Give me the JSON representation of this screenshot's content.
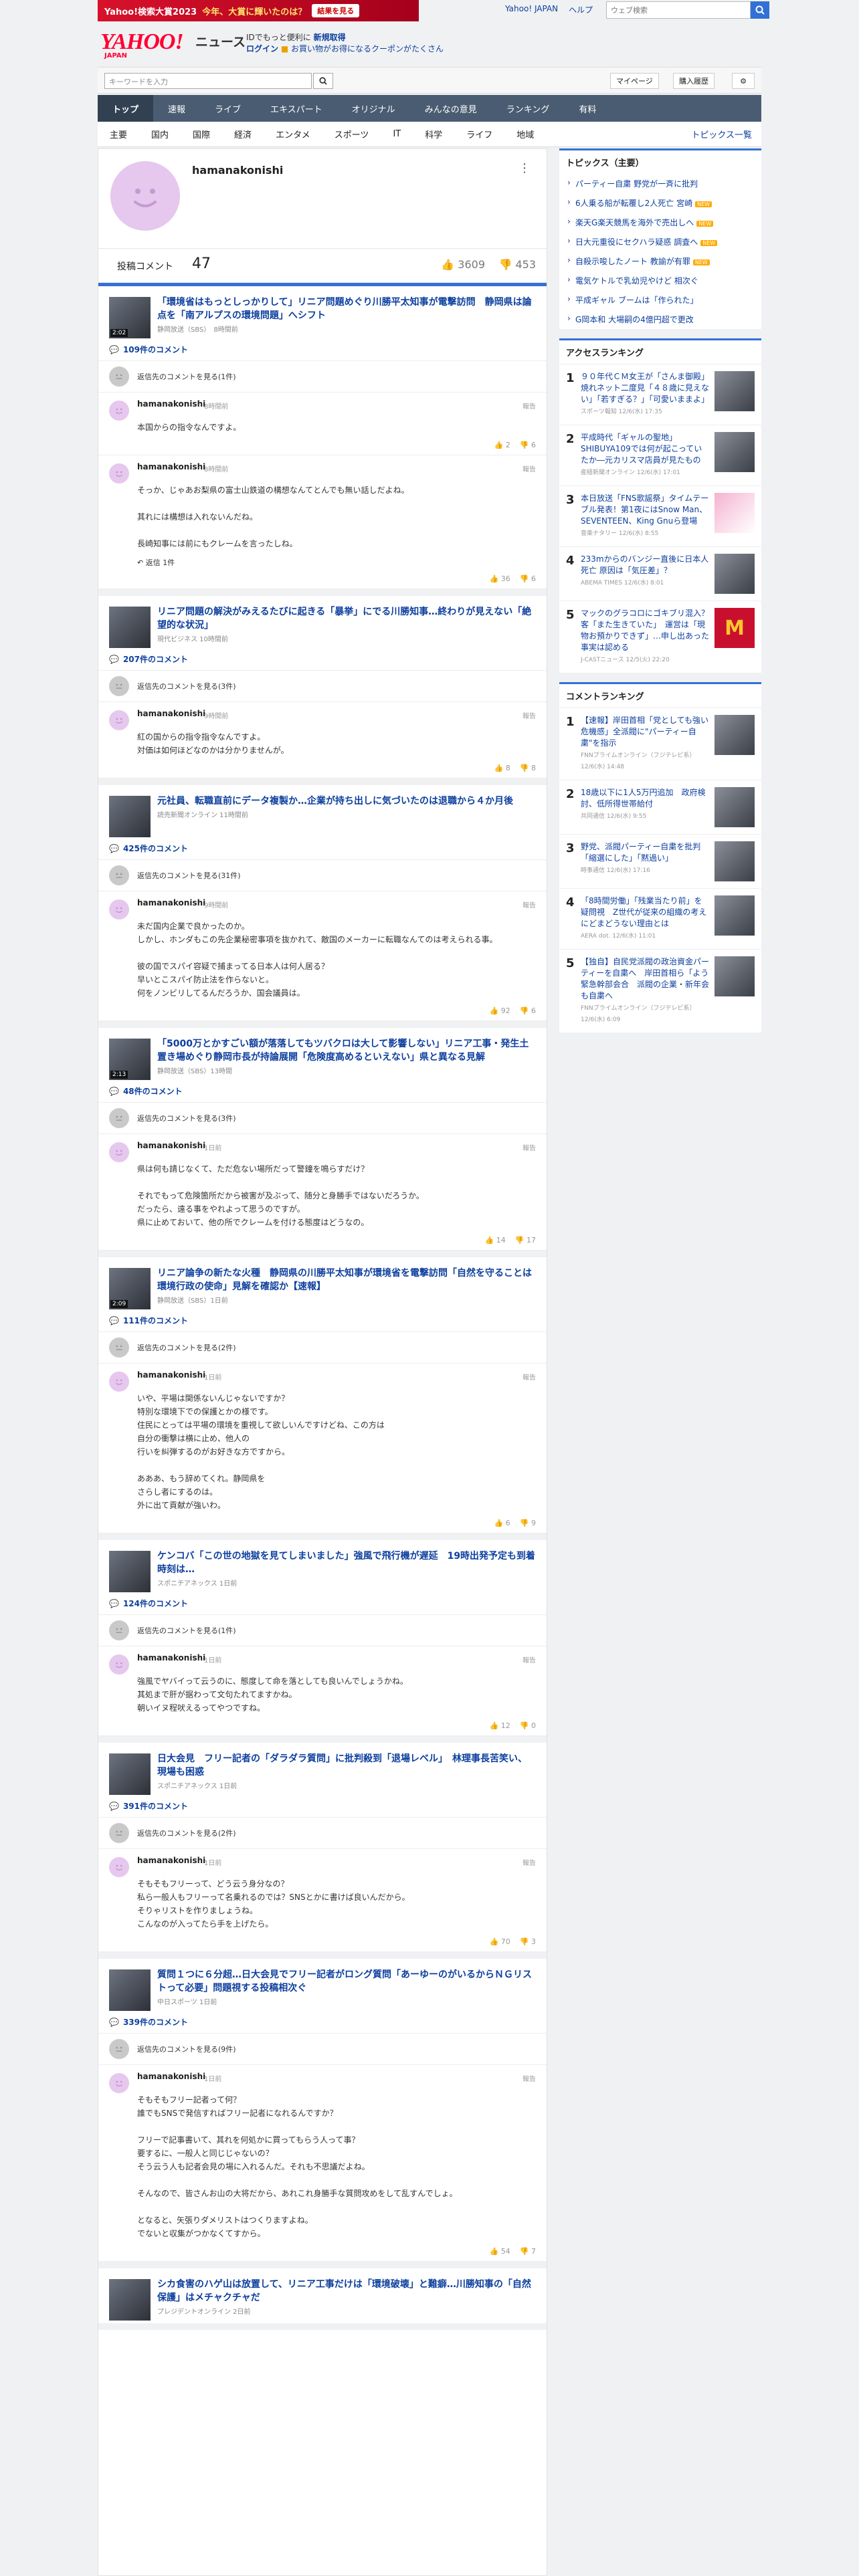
{
  "promo": {
    "text": "Yahoo!検索大賞2023",
    "highlight": "今年、大賞に輝いたのは？",
    "button": "結果を見る"
  },
  "topnav": [
    "Yahoo! JAPAN",
    "ヘルプ"
  ],
  "top_search_placeholder": "ウェブ検索",
  "logo": {
    "brand": "YAHOO!",
    "sub": "JAPAN",
    "product": "ニュース"
  },
  "header_promo": {
    "line1a": "IDでもっと便利に",
    "line1b": "新規取得",
    "line2a": "ログイン",
    "line2b": "お買い物がお得になるクーポンがたくさん"
  },
  "searchbar": {
    "placeholder": "キーワードを入力",
    "mypage": "マイページ",
    "history": "購入履歴"
  },
  "mainnav": [
    "トップ",
    "速報",
    "ライブ",
    "エキスパート",
    "オリジナル",
    "みんなの意見",
    "ランキング",
    "有料"
  ],
  "subnav": [
    "主要",
    "国内",
    "国際",
    "経済",
    "エンタメ",
    "スポーツ",
    "IT",
    "科学",
    "ライフ",
    "地域"
  ],
  "subnav_right": "トピックス一覧",
  "profile": {
    "username": "hamanakonishi",
    "posted_label": "投稿コメント",
    "posted_count": "47",
    "up": "3609",
    "down": "453"
  },
  "blocks": [
    {
      "title": "「環境省はもっとしっかりして」リニア問題めぐり川勝平太知事が電撃訪問　静岡県は論点を「南アルプスの環境問題」へシフト",
      "source": "静岡放送（SBS）　8時間前",
      "video": "2:02",
      "comment_count": "109件のコメント",
      "prev": "返信先のコメントを見る(1件)",
      "comments": [
        {
          "name": "hamanakonishi",
          "time": "8時間前",
          "body": "本国からの指令なんですよ。",
          "up": "2",
          "down": "6",
          "reply": ""
        },
        {
          "name": "hamanakonishi",
          "time": "8時間前",
          "body": "そっか、じゃあお梨県の富士山鉄道の構想なんてとんでも無い話しだよね。\n\n其れには構想は入れないんだね。\n\n長崎知事には前にもクレームを言ったしね。",
          "up": "36",
          "down": "6",
          "reply": "返信 1件"
        }
      ]
    },
    {
      "title": "リニア問題の解決がみえるたびに起きる「暴挙」にでる川勝知事…終わりが見えない「絶望的な状況」",
      "source": "現代ビジネス 10時間前",
      "video": "",
      "comment_count": "207件のコメント",
      "prev": "返信先のコメントを見る(3件)",
      "comments": [
        {
          "name": "hamanakonishi",
          "time": "9時間前",
          "body": "紅の国からの指令指令なんですよ。\n対価は如何ほどなのかは分かりませんが。",
          "up": "8",
          "down": "8",
          "reply": ""
        }
      ]
    },
    {
      "title": "元社員、転職直前にデータ複製か…企業が持ち出しに気づいたのは退職から４か月後",
      "source": "読売新聞オンライン 11時間前",
      "video": "",
      "comment_count": "425件のコメント",
      "prev": "返信先のコメントを見る(31件)",
      "comments": [
        {
          "name": "hamanakonishi",
          "time": "9時間前",
          "body": "未だ国内企業で良かったのか。\nしかし、ホンダもこの先企業秘密事項を抜かれて、敵国のメーカーに転職なんてのは考えられる事。\n\n彼の国でスパイ容疑で捕まってる日本人は何人居る？\n早いとこスパイ防止法を作らないと。\n何をノンビリしてるんだろうか、国会議員は。",
          "up": "92",
          "down": "6",
          "reply": ""
        }
      ]
    },
    {
      "title": "「5000万とかすごい額が落落してもツバクロは大して影響しない」リニア工事・発生土置き場めぐり静岡市長が持論展開「危険度高めるといえない」県と異なる見解",
      "source": "静岡放送（SBS）13時間",
      "video": "2:13",
      "comment_count": "48件のコメント",
      "prev": "返信先のコメントを見る(3件)",
      "comments": [
        {
          "name": "hamanakonishi",
          "time": "1日前",
          "body": "県は何も請じなくて、ただ危ない場所だって警鐘を鳴らすだけ？\n\nそれでもって危険箇所だから被害が及ぶって、随分と身勝手ではないだろうか。\nだったら、遠る事をやれよって思うのですが。\n県に止めておいて、他の所でクレームを付ける態度はどうなの。",
          "up": "14",
          "down": "17",
          "reply": ""
        }
      ]
    },
    {
      "title": "リニア論争の新たな火種　静岡県の川勝平太知事が環境省を電撃訪問「自然を守ることは環境行政の使命」見解を確認か【速報】",
      "source": "静岡放送（SBS）1日前",
      "video": "2:09",
      "comment_count": "111件のコメント",
      "prev": "返信先のコメントを見る(2件)",
      "comments": [
        {
          "name": "hamanakonishi",
          "time": "1日前",
          "body": "いや、平場は関係ないんじゃないですか？\n特別な環境下での保護とかの様です。\n住民にとっては平場の環境を重視して欲しいんですけどね、この方は\n自分の衝撃は横に止め、他人の\n行いを糾弾するのがお好きな方ですから。\n\nあああ、もう辞めてくれ。静岡県を\nさらし者にするのは。\n外に出て貢献が強いわ。",
          "up": "6",
          "down": "9",
          "reply": ""
        }
      ]
    },
    {
      "title": "ケンコバ「この世の地獄を見てしまいました」強風で飛行機が遅延　19時出発予定も到着時刻は…",
      "source": "スポニチアネックス 1日前",
      "video": "",
      "comment_count": "124件のコメント",
      "prev": "返信先のコメントを見る(1件)",
      "comments": [
        {
          "name": "hamanakonishi",
          "time": "1日前",
          "body": "強風でヤバイって云うのに、態度して命を落としても良いんでしょうかね。\n其処まで肝が据わって文句たれてますかね。\n朝いイヌ程吠えるってやつですね。",
          "up": "12",
          "down": "0",
          "reply": ""
        }
      ]
    },
    {
      "title": "日大会見　フリー記者の「ダラダラ質問」に批判殺到「退場レベル」　林理事長苦笑い、現場も困惑",
      "source": "スポニチアネックス 1日前",
      "video": "",
      "comment_count": "391件のコメント",
      "prev": "返信先のコメントを見る(2件)",
      "comments": [
        {
          "name": "hamanakonishi",
          "time": "1日前",
          "body": "そもそもフリーって、どう云う身分なの？\n私ら一般人もフリーって名乗れるのでは？SNSとかに書けば良いんだから。\nそりゃリストを作りましょうね。\nこんなのが入ってたら手を上げたら。",
          "up": "70",
          "down": "3",
          "reply": ""
        }
      ]
    },
    {
      "title": "質問１つに６分超…日大会見でフリー記者がロング質問「あーゆーのがいるからＮＧリストって必要」問題視する投稿相次ぐ",
      "source": "中日スポーツ 1日前",
      "video": "",
      "comment_count": "339件のコメント",
      "prev": "返信先のコメントを見る(9件)",
      "comments": [
        {
          "name": "hamanakonishi",
          "time": "1日前",
          "body": "そもそもフリー記者って何？\n誰でもSNSで発信すればフリー記者になれるんですか？\n\nフリーで記事書いて、其れを何処かに買ってもらう人って事？\n要するに、一般人と同じじゃないの？\nそう云う人も記者会見の場に入れるんだ。それも不思議だよね。\n\nそんなので、皆さんお山の大将だから、あれこれ身勝手な質問攻めをして乱すんでしょ。\n\nとなると、矢張りダメリストはつくりますよね。\nでないと収集がつかなくてすから。",
          "up": "54",
          "down": "7",
          "reply": ""
        }
      ]
    },
    {
      "title": "シカ食害のハゲ山は放置して、リニア工事だけは「環境破壊」と難癖…川勝知事の「自然保護」はメチャクチャだ",
      "source": "プレジデントオンライン 2日前",
      "video": "",
      "comment_count": "",
      "prev": "",
      "comments": []
    }
  ],
  "topics": {
    "heading": "トピックス（主要）",
    "new_label": "NEW",
    "items": [
      {
        "text": "パーティー自粛 野党が一斉に批判",
        "new": false
      },
      {
        "text": "6人乗る船が転覆し2人死亡 宮崎",
        "new": true
      },
      {
        "text": "楽天G楽天競馬を海外で売出しへ",
        "new": true
      },
      {
        "text": "日大元重役にセクハラ疑惑 調査へ",
        "new": true
      },
      {
        "text": "自殺示唆したノート 教諭が有罪",
        "new": true
      },
      {
        "text": "電気ケトルで乳幼児やけど 相次ぐ",
        "new": false
      },
      {
        "text": "平成ギャル ブームは「作られた」",
        "new": false
      },
      {
        "text": "G岡本和 大場嗣の4億円超で更改",
        "new": false
      }
    ]
  },
  "access_ranking": {
    "heading": "アクセスランキング",
    "items": [
      {
        "no": "1",
        "text": "９０年代ＣＭ女王が「さんま御殿」焼れネット二度見「４８歳に見えない」「若すぎる？」「可愛いままよ」",
        "meta": "スポーツ報知 12/6(水) 17:35",
        "img": ""
      },
      {
        "no": "2",
        "text": "平成時代「ギャルの聖地」SHIBUYA109では何が起こっていたか―元カリスマ店員が見たもの",
        "meta": "産経新聞オンライン 12/6(水) 17:01",
        "img": ""
      },
      {
        "no": "3",
        "text": "本日放送「FNS歌謡祭」タイムテーブル発表！第1夜にはSnow Man、SEVENTEEN、King Gnuら登場",
        "meta": "音楽ナタリー 12/6(水) 8:55",
        "img": "pink"
      },
      {
        "no": "4",
        "text": "233mからのバンジー直後に日本人死亡 原因は「気圧差」？",
        "meta": "ABEMA TIMES 12/6(水) 8:01",
        "img": ""
      },
      {
        "no": "5",
        "text": "マックのグラコロにゴキブリ混入？客「また生きていた」　運営は「現物お預かりできず」…申し出あった事実は認める",
        "meta": "J-CASTニュース 12/5(火) 22:20",
        "img": "red"
      }
    ]
  },
  "comment_ranking": {
    "heading": "コメントランキング",
    "items": [
      {
        "no": "1",
        "text": "【速報】岸田首相「党としても強い危機感」全派閥に\"パーティー自粛\"を指示",
        "meta": "FNNプライムオンライン（フジテレビ系） 12/6(水) 14:48",
        "img": ""
      },
      {
        "no": "2",
        "text": "18歳以下に1人5万円追加　政府検討、低所得世帯給付",
        "meta": "共同通信 12/6(水) 9:55",
        "img": ""
      },
      {
        "no": "3",
        "text": "野党、派閥パーティー自粛を批判「縮選にした」「黙過い」",
        "meta": "時事通信 12/6(水) 17:16",
        "img": ""
      },
      {
        "no": "4",
        "text": "「8時間労働」「残業当たり前」を疑問視　Z世代が従来の組織の考えにどまどうない理由とは",
        "meta": "AERA dot. 12/6(水) 11:01",
        "img": ""
      },
      {
        "no": "5",
        "text": "【独自】自民党派閥の政治資金パーティーを自粛へ　岸田首相ら「よう緊急幹部会合　派閥の企業・新年会も自粛へ",
        "meta": "FNNプライムオンライン（フジテレビ系） 12/6(水) 6:09",
        "img": ""
      }
    ]
  },
  "colors": {
    "accent": "#3370d6",
    "nav": "#4a5c72",
    "brand": "#ff0033",
    "link": "#0d3f9e"
  },
  "icons": [
    "search-icon",
    "gear-icon",
    "thumb-up-icon",
    "thumb-down-icon",
    "comment-icon",
    "reply-icon",
    "kebab-icon"
  ]
}
